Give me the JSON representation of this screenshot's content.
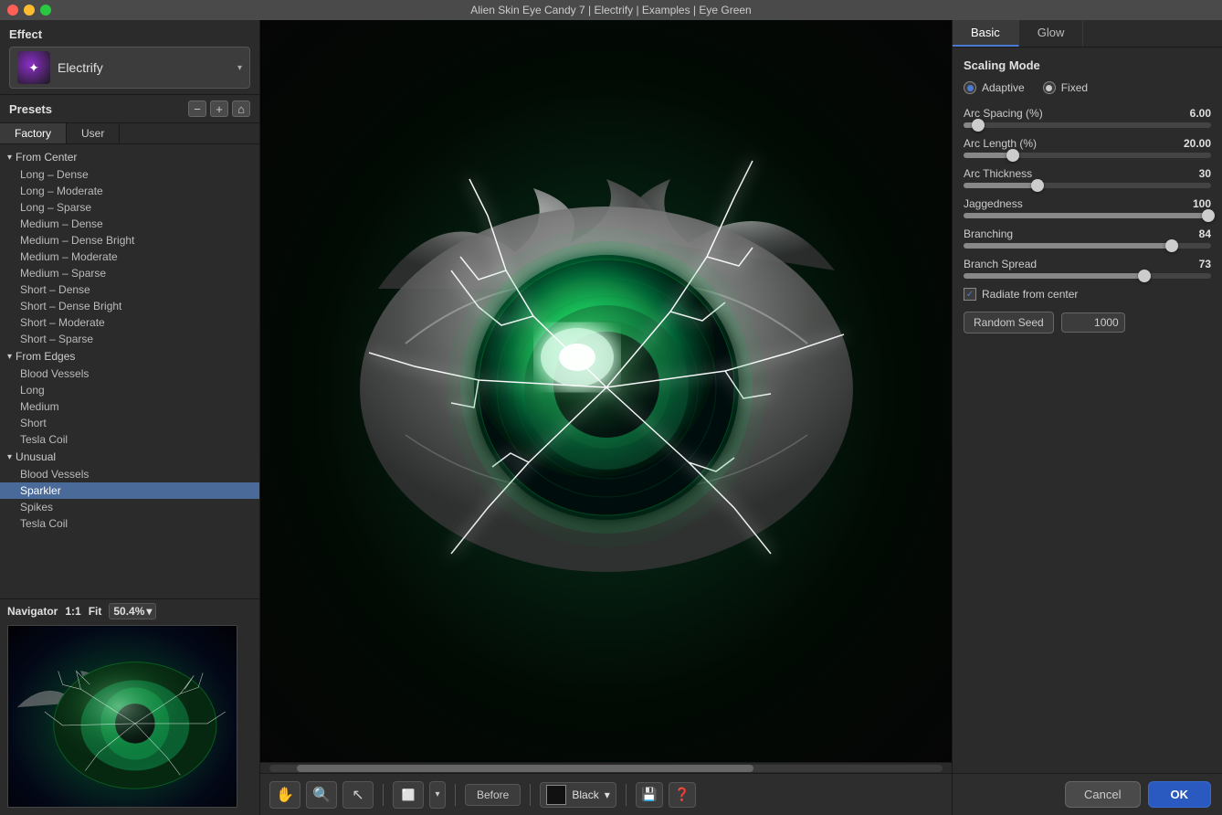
{
  "app": {
    "title": "Alien Skin Eye Candy 7 | Electrify | Examples | Eye Green"
  },
  "effect": {
    "label": "Effect",
    "name": "Electrify",
    "dropdown_chevron": "▾"
  },
  "presets": {
    "label": "Presets",
    "minus_btn": "−",
    "plus_btn": "+",
    "home_btn": "⌂",
    "tabs": [
      {
        "id": "factory",
        "label": "Factory",
        "active": true
      },
      {
        "id": "user",
        "label": "User",
        "active": false
      }
    ],
    "groups": [
      {
        "label": "From Center",
        "items": [
          {
            "label": "Long – Dense",
            "selected": false
          },
          {
            "label": "Long – Moderate",
            "selected": false
          },
          {
            "label": "Long – Sparse",
            "selected": false
          },
          {
            "label": "Medium – Dense",
            "selected": false
          },
          {
            "label": "Medium – Dense Bright",
            "selected": false
          },
          {
            "label": "Medium – Moderate",
            "selected": false
          },
          {
            "label": "Medium – Sparse",
            "selected": false
          },
          {
            "label": "Short – Dense",
            "selected": false
          },
          {
            "label": "Short – Dense Bright",
            "selected": false
          },
          {
            "label": "Short – Moderate",
            "selected": false
          },
          {
            "label": "Short – Sparse",
            "selected": false
          }
        ]
      },
      {
        "label": "From Edges",
        "items": [
          {
            "label": "Blood Vessels",
            "selected": false
          },
          {
            "label": "Long",
            "selected": false
          },
          {
            "label": "Medium",
            "selected": false
          },
          {
            "label": "Short",
            "selected": false
          },
          {
            "label": "Tesla Coil",
            "selected": false
          }
        ]
      },
      {
        "label": "Unusual",
        "items": [
          {
            "label": "Blood Vessels",
            "selected": false
          },
          {
            "label": "Sparkler",
            "selected": true
          },
          {
            "label": "Spikes",
            "selected": false
          },
          {
            "label": "Tesla Coil",
            "selected": false
          }
        ]
      }
    ]
  },
  "navigator": {
    "label": "Navigator",
    "ratio": "1:1",
    "fit": "Fit",
    "zoom": "50.4%",
    "zoom_chevron": "▾"
  },
  "canvas": {
    "before_btn": "Before",
    "color_label": "Black",
    "color_chevron": "▾"
  },
  "right_panel": {
    "tabs": [
      {
        "label": "Basic",
        "active": true
      },
      {
        "label": "Glow",
        "active": false
      }
    ],
    "scaling_mode": {
      "label": "Scaling Mode",
      "options": [
        {
          "label": "Adaptive",
          "checked": true
        },
        {
          "label": "Fixed",
          "checked": false
        }
      ]
    },
    "params": [
      {
        "id": "arc_spacing",
        "label": "Arc Spacing (%)",
        "value": "6.00",
        "pct": 6,
        "thumb_pct": 6
      },
      {
        "id": "arc_length",
        "label": "Arc Length (%)",
        "value": "20.00",
        "pct": 20,
        "thumb_pct": 20
      },
      {
        "id": "arc_thickness",
        "label": "Arc Thickness",
        "value": "30",
        "pct": 30,
        "thumb_pct": 30
      },
      {
        "id": "jaggedness",
        "label": "Jaggedness",
        "value": "100",
        "pct": 100,
        "thumb_pct": 100
      },
      {
        "id": "branching",
        "label": "Branching",
        "value": "84",
        "pct": 84,
        "thumb_pct": 84
      },
      {
        "id": "branch_spread",
        "label": "Branch Spread",
        "value": "73",
        "pct": 73,
        "thumb_pct": 73
      }
    ],
    "radiate_checkbox": {
      "label": "Radiate from center",
      "checked": true
    },
    "random_seed": {
      "btn_label": "Random Seed",
      "value": "1000"
    }
  },
  "bottom_bar": {
    "cancel_label": "Cancel",
    "ok_label": "OK"
  }
}
